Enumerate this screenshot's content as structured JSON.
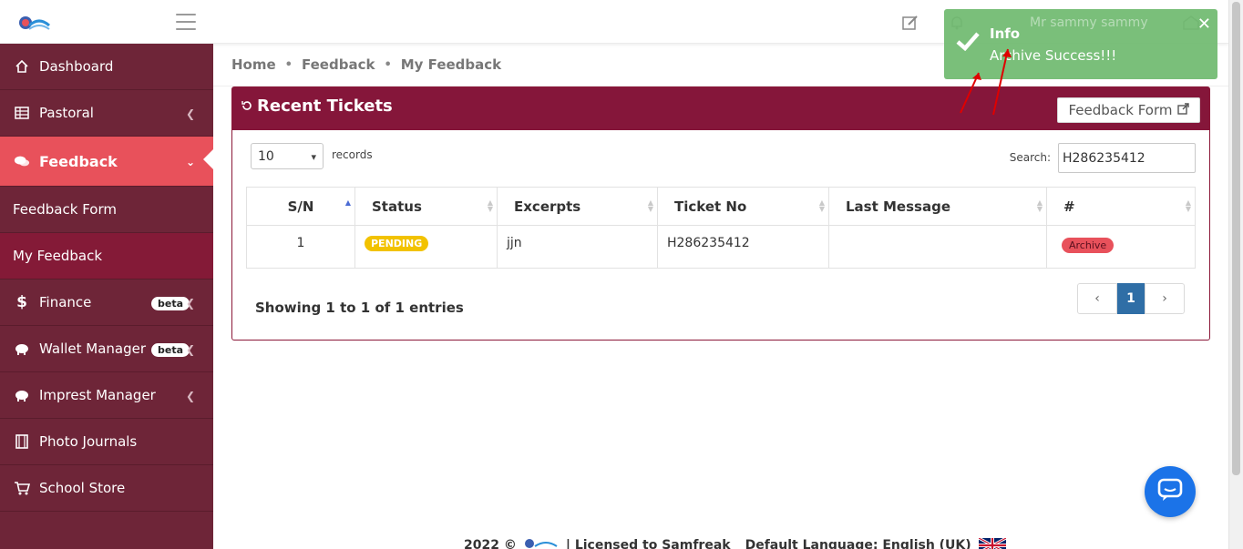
{
  "topbar": {
    "logo_icon": "educare-logo",
    "user_name": "Mr sammy sammy"
  },
  "sidebar": {
    "items": [
      {
        "label": "Dashboard",
        "icon": "home-icon"
      },
      {
        "label": "Pastoral",
        "icon": "table-icon"
      },
      {
        "label": "Feedback",
        "icon": "comments-icon"
      },
      {
        "label": "Feedback Form"
      },
      {
        "label": "My Feedback"
      },
      {
        "label": "Finance",
        "icon": "dollar-icon",
        "badge": "beta"
      },
      {
        "label": "Wallet Manager",
        "icon": "piggy-bank-icon",
        "badge": "beta"
      },
      {
        "label": "Imprest Manager",
        "icon": "piggy-bank-icon"
      },
      {
        "label": "Photo Journals",
        "icon": "film-icon"
      },
      {
        "label": "School Store",
        "icon": "cart-icon"
      }
    ]
  },
  "breadcrumb": {
    "items": [
      "Home",
      "Feedback",
      "My Feedback"
    ]
  },
  "card": {
    "title": "Recent Tickets",
    "form_button": "Feedback Form"
  },
  "table_controls": {
    "page_length": "10",
    "records_label": "records",
    "search_label": "Search:",
    "search_value": "H286235412"
  },
  "table": {
    "columns": [
      "S/N",
      "Status",
      "Excerpts",
      "Ticket No",
      "Last Message",
      "#"
    ],
    "rows": [
      {
        "sn": "1",
        "status": "PENDING",
        "excerpt": "jjn",
        "ticket_no": "H286235412",
        "last_message": "",
        "action": "Archive"
      }
    ]
  },
  "pagination": {
    "info": "Showing 1 to 1 of 1 entries",
    "prev": "‹",
    "current": "1",
    "next": "›"
  },
  "footer": {
    "year": "2022 ©",
    "license": "| Licensed to Samfreak",
    "language": "Default Language: English (UK)"
  },
  "toast": {
    "title": "Info",
    "message": "Archive Success!!!",
    "close": "✕"
  },
  "colors": {
    "sidebar": "#6e2538",
    "active": "#e8515b",
    "header": "#85163a",
    "toast": "#70ba70",
    "chat": "#1b73e8"
  }
}
